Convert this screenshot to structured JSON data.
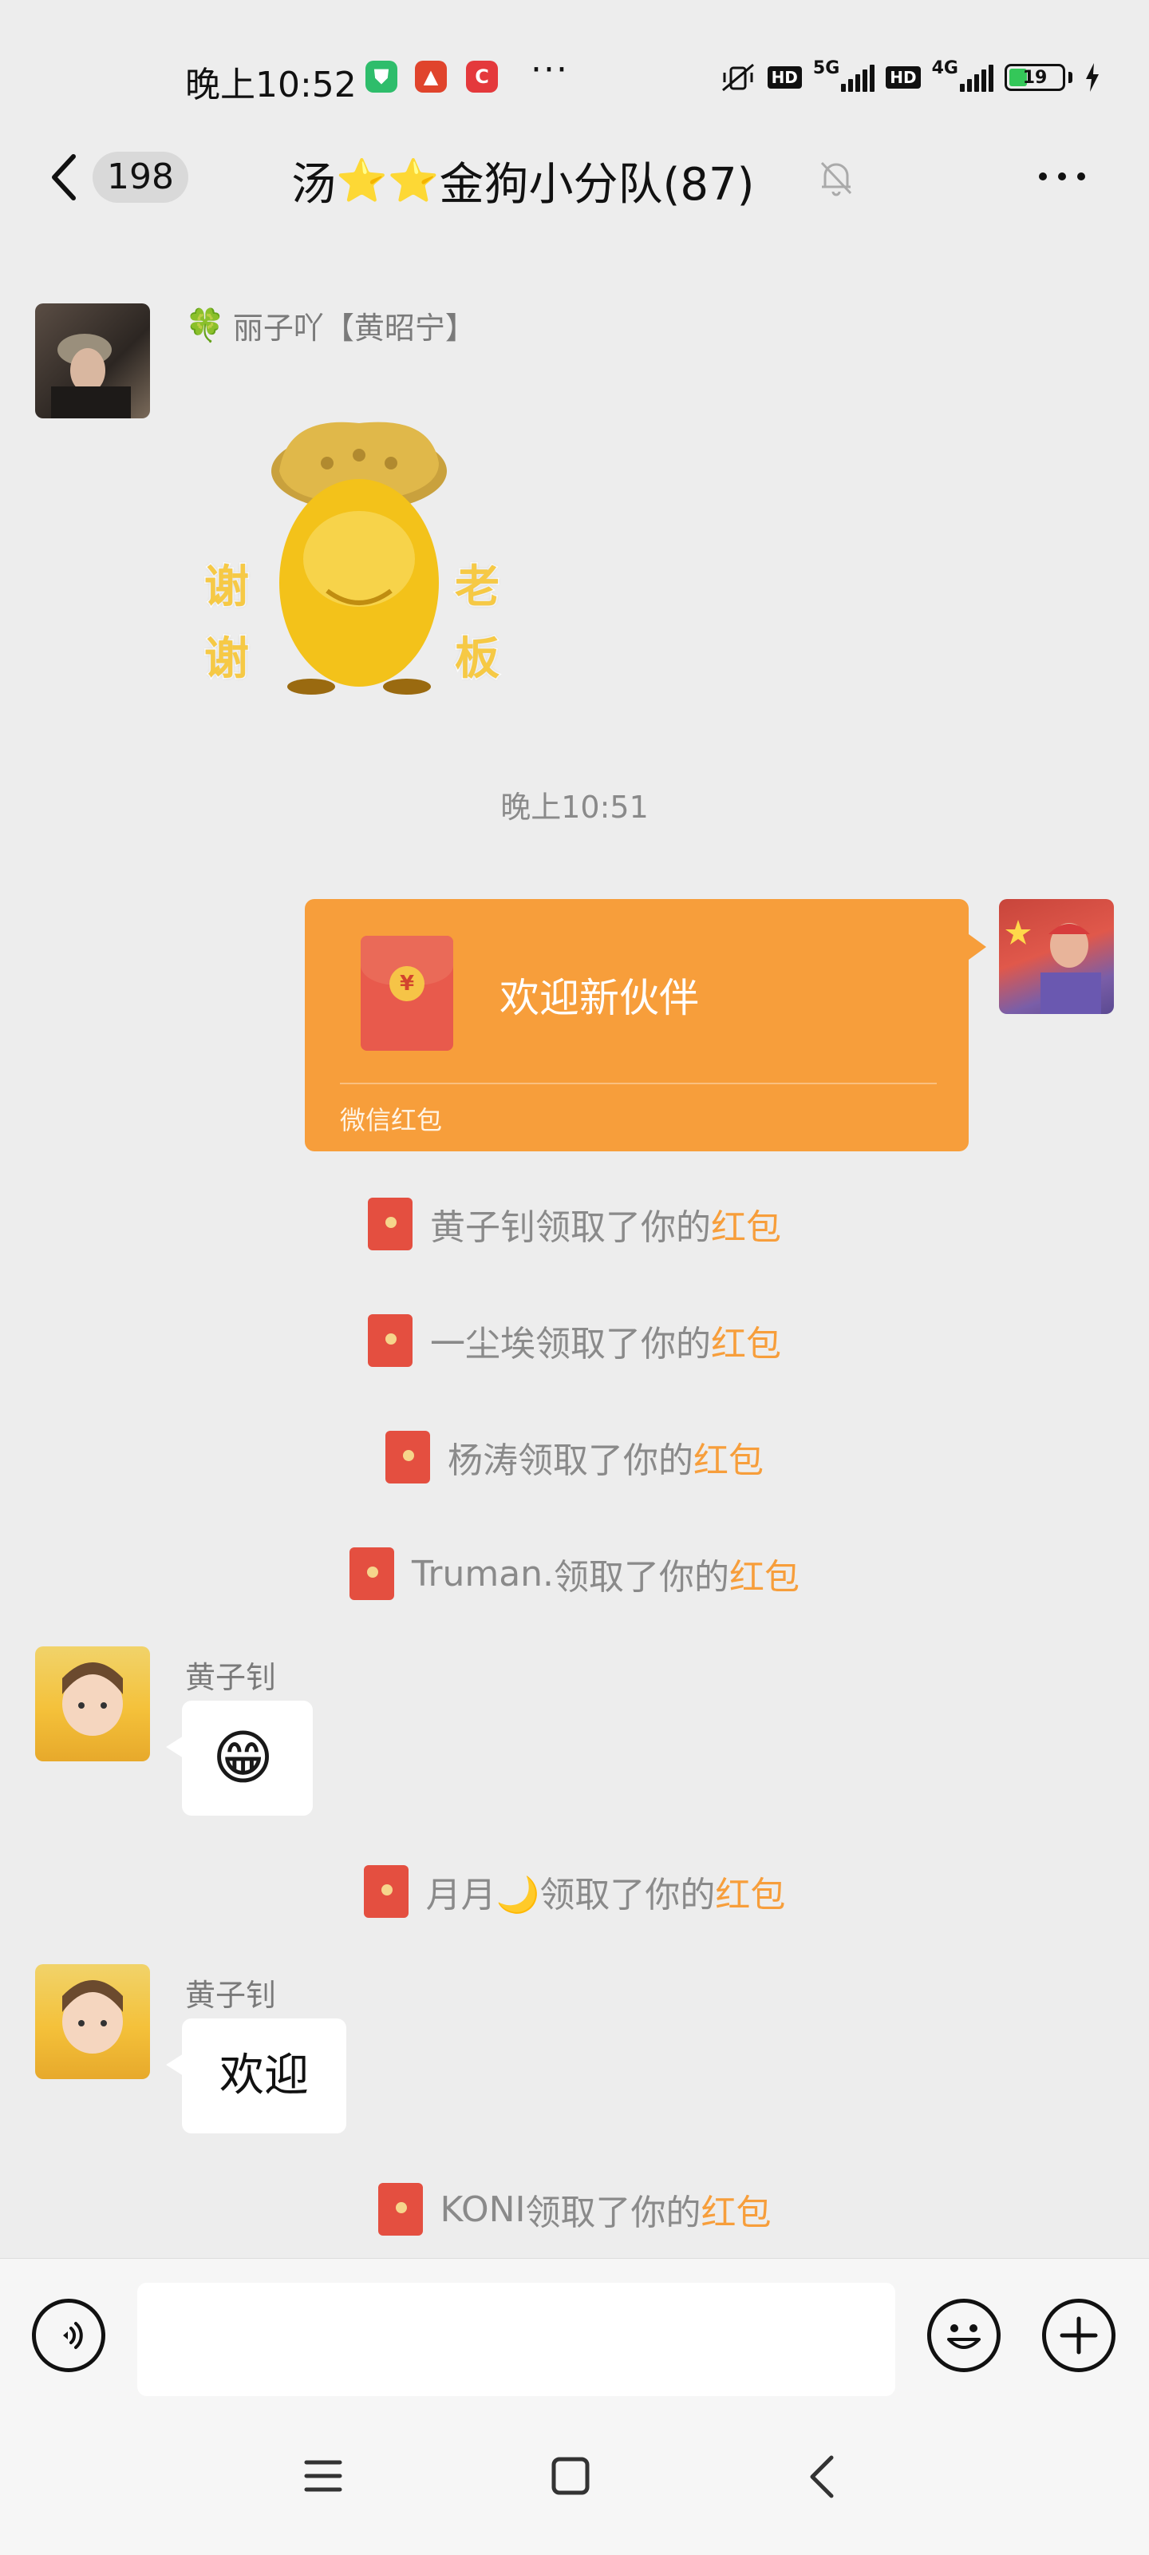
{
  "status_bar": {
    "time": "晚上10:52",
    "more": "···",
    "hd1": "HD",
    "net1": "5G",
    "hd2": "HD",
    "net2": "4G",
    "battery": "19"
  },
  "header": {
    "unread": "198",
    "title_prefix": "汤",
    "title_suffix": "金狗小分队(87)",
    "star_glyph": "⭐"
  },
  "messages": {
    "sender_1": {
      "leaf": "🍀",
      "name": "丽子吖【黄昭宁】"
    },
    "sticker": {
      "left_top": "谢",
      "left_bottom": "谢",
      "right_top": "老",
      "right_bottom": "板"
    },
    "timestamp": "晚上10:51",
    "red_packet": {
      "coin": "¥",
      "title": "欢迎新伙伴",
      "footer": "微信红包"
    },
    "notices": [
      {
        "name": "黄子钊",
        "text": "领取了你的",
        "highlight": "红包"
      },
      {
        "name": "一尘埃",
        "text": "领取了你的",
        "highlight": "红包"
      },
      {
        "name": "杨涛",
        "text": "领取了你的",
        "highlight": "红包"
      },
      {
        "name": "Truman.",
        "text": "领取了你的",
        "highlight": "红包"
      },
      {
        "name": "月月🌙",
        "text": "领取了你的",
        "highlight": "红包"
      },
      {
        "name": "KONI ",
        "text": "领取了你的",
        "highlight": "红包"
      }
    ],
    "huang_1": {
      "name": "黄子钊",
      "emoji": "😁"
    },
    "huang_2": {
      "name": "黄子钊",
      "text": "欢迎"
    }
  },
  "input": {
    "placeholder": ""
  },
  "icons": {
    "back": "chevron-left-icon",
    "mute": "bell-off-icon",
    "more": "more-horizontal-icon",
    "voice": "voice-icon",
    "emoji": "smiley-icon",
    "plus": "plus-icon",
    "nav_menu": "menu-icon",
    "nav_home": "home-square-icon",
    "nav_back": "back-triangle-icon"
  },
  "colors": {
    "background": "#ededed",
    "red_packet": "#f79e3b",
    "highlight": "#f79e3b",
    "envelope": "#e44f40"
  }
}
